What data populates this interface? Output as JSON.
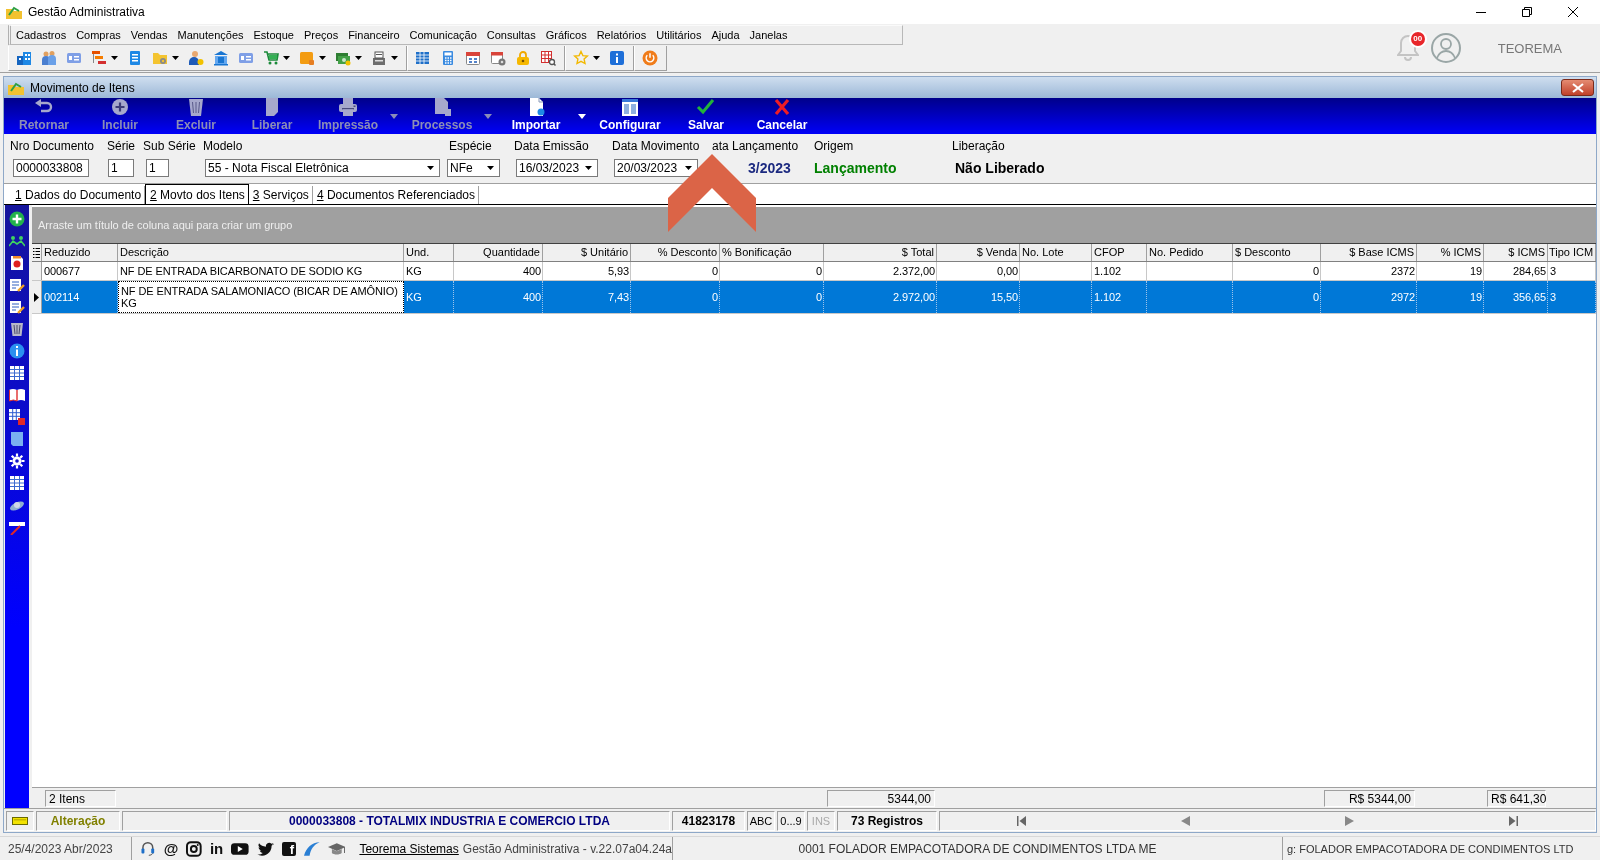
{
  "window": {
    "title": "Gestão Administrativa"
  },
  "menu": [
    "Cadastros",
    "Compras",
    "Vendas",
    "Manutenções",
    "Estoque",
    "Preços",
    "Financeiro",
    "Comunicação",
    "Consultas",
    "Gráficos",
    "Relatórios",
    "Utilitários",
    "Ajuda",
    "Janelas"
  ],
  "notifications": {
    "badge": "00"
  },
  "user": {
    "name": "TEOREMA"
  },
  "document_window": {
    "title": "Movimento de Itens",
    "actions": [
      {
        "label": "Retornar",
        "disabled": true,
        "dropdown": false
      },
      {
        "label": "Incluir",
        "disabled": true,
        "dropdown": false
      },
      {
        "label": "Excluir",
        "disabled": true,
        "dropdown": false
      },
      {
        "label": "Liberar",
        "disabled": true,
        "dropdown": false
      },
      {
        "label": "Impressão",
        "disabled": true,
        "dropdown": true
      },
      {
        "label": "Processos",
        "disabled": true,
        "dropdown": true
      },
      {
        "label": "Importar",
        "disabled": false,
        "dropdown": true
      },
      {
        "label": "Configurar",
        "disabled": false,
        "dropdown": false
      },
      {
        "label": "Salvar",
        "disabled": false,
        "dropdown": false
      },
      {
        "label": "Cancelar",
        "disabled": false,
        "dropdown": false
      }
    ],
    "fields": [
      {
        "kind": "text",
        "label": "Nro Documento",
        "value": "0000033808"
      },
      {
        "kind": "text",
        "label": "Série",
        "value": "1"
      },
      {
        "kind": "text",
        "label": "Sub Série",
        "value": "1"
      },
      {
        "kind": "select",
        "label": "Modelo",
        "value": "55 - Nota Fiscal Eletrônica"
      },
      {
        "kind": "select",
        "label": "Espécie",
        "value": "NFe"
      },
      {
        "kind": "date",
        "label": "Data Emissão",
        "value": "16/03/2023"
      },
      {
        "kind": "date",
        "label": "Data Movimento",
        "value": "20/03/2023"
      },
      {
        "kind": "display",
        "label": "ata Lançamento",
        "value": "3/2023",
        "color": "#1c2a80"
      },
      {
        "kind": "display",
        "label": "Origem",
        "value": "Lançamento",
        "color": "#008000"
      },
      {
        "kind": "display",
        "label": "Liberação",
        "value": "Não Liberado",
        "color": "#000000"
      }
    ],
    "tabs": [
      {
        "label": "1 Dados do Documento",
        "selected": false
      },
      {
        "label": "2 Movto dos Itens",
        "selected": true
      },
      {
        "label": "3 Serviços",
        "selected": false
      },
      {
        "label": "4 Documentos Referenciados",
        "selected": false
      }
    ],
    "grid": {
      "group_hint": "Arraste um título de coluna aqui para criar um grupo",
      "columns": [
        {
          "label": "Reduzido",
          "kind": "text",
          "focused": false,
          "summary": "2 Itens"
        },
        {
          "label": "Descrição",
          "kind": "text",
          "focused": true
        },
        {
          "label": "Und.",
          "kind": "text",
          "focused": false
        },
        {
          "label": "Quantidade",
          "kind": "number",
          "focused": false
        },
        {
          "label": "$ Unitário",
          "kind": "number",
          "focused": false
        },
        {
          "label": "% Desconto",
          "kind": "number",
          "focused": false
        },
        {
          "label": "% Bonificação",
          "kind": "number",
          "focused": false
        },
        {
          "label": "$ Total",
          "kind": "number",
          "focused": false,
          "summary": "5344,00"
        },
        {
          "label": "$ Venda",
          "kind": "number",
          "focused": false
        },
        {
          "label": "No. Lote",
          "kind": "text",
          "focused": false
        },
        {
          "label": "CFOP",
          "kind": "text",
          "focused": false
        },
        {
          "label": "No. Pedido",
          "kind": "text",
          "focused": false
        },
        {
          "label": "$ Desconto",
          "kind": "number",
          "focused": false
        },
        {
          "label": "$ Base ICMS",
          "kind": "number",
          "focused": false,
          "summary": "R$ 5344,00"
        },
        {
          "label": "% ICMS",
          "kind": "number",
          "focused": false
        },
        {
          "label": "$ ICMS",
          "kind": "number",
          "focused": false,
          "summary": "R$ 641,30"
        },
        {
          "label": "Tipo ICM",
          "kind": "text",
          "focused": false
        }
      ],
      "rows": [
        {
          "selected": false,
          "cells": [
            "000677",
            "NF DE ENTRADA BICARBONATO DE SODIO KG",
            "KG",
            "400",
            "5,93",
            "0",
            "0",
            "2.372,00",
            "0,00",
            null,
            "1.102",
            null,
            "0",
            "2372",
            "19",
            "284,65",
            "3"
          ]
        },
        {
          "selected": true,
          "cells": [
            "002114",
            "NF DE ENTRADA SALAMONIACO (BICAR DE AMÔNIO) KG",
            "KG",
            "400",
            "7,43",
            "0",
            "0",
            "2.972,00",
            "15,50",
            null,
            "1.102",
            null,
            "0",
            "2972",
            "19",
            "356,65",
            "3"
          ]
        }
      ]
    },
    "status_bar": {
      "mode": "Alteração",
      "record": "0000033808 - TOTALMIX INDUSTRIA E COMERCIO LTDA",
      "code": "41823178",
      "indicators": [
        {
          "label": "ABC",
          "on": true
        },
        {
          "label": "0...9",
          "on": true
        },
        {
          "label": "INS",
          "on": false
        }
      ],
      "count": "73 Registros"
    }
  },
  "footer_bar": {
    "date": "25/4/2023 Abr/2023",
    "social": [
      {
        "kind": "headset"
      },
      {
        "kind": "text",
        "label": "@"
      },
      {
        "kind": "camera"
      },
      {
        "kind": "text",
        "label": "in"
      },
      {
        "kind": "play"
      },
      {
        "kind": "bird"
      },
      {
        "kind": "tile",
        "label": "f"
      },
      {
        "kind": "swoosh"
      },
      {
        "kind": "cap"
      }
    ],
    "link": "Teorema Sistemas",
    "version": "Gestão Administrativa - v.22.07a04.24a",
    "company": "0001 FOLADOR EMPACOTADORA DE CONDIMENTOS LTDA ME",
    "registration": "g: FOLADOR EMPACOTADORA DE CONDIMENTOS LTD"
  },
  "annotation": {
    "kind": "chevron-up"
  }
}
